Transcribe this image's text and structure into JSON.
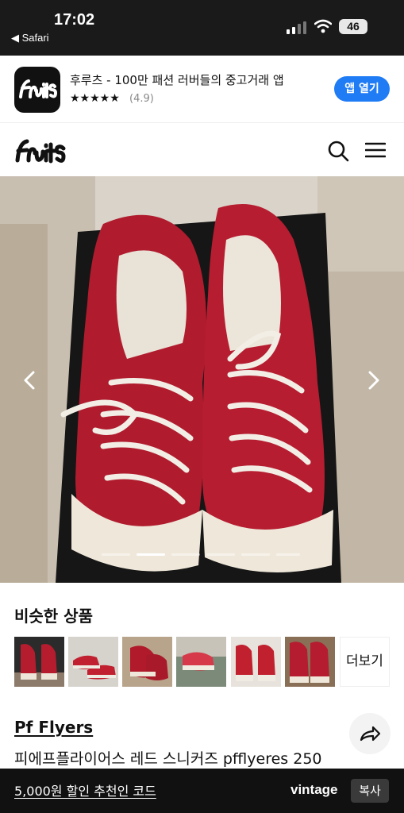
{
  "status_bar": {
    "time": "17:02",
    "back_label": "◀ Safari",
    "battery": "46"
  },
  "app_banner": {
    "title": "후루츠 - 100만 패션 러버들의 중고거래 앱",
    "stars": "★★★★★",
    "rating": "(4.9)",
    "open_label": "앱 열기",
    "open_color": "#1f7cf5"
  },
  "header": {
    "logo_text": "fruits",
    "icons": [
      "search-icon",
      "menu-icon"
    ]
  },
  "gallery": {
    "image": "red canvas sneakers on black box",
    "current_index": 2,
    "total": 6
  },
  "similar": {
    "title": "비슷한 상품",
    "more_label": "더보기"
  },
  "product": {
    "brand": "Pf Flyers",
    "name": "피에프플라이어스 레드 스니커즈 pfflyeres 250"
  },
  "bottom_bar": {
    "coupon_text": "5,000원 할인 추천인 코드",
    "code": "vintage",
    "copy_label": "복사"
  }
}
